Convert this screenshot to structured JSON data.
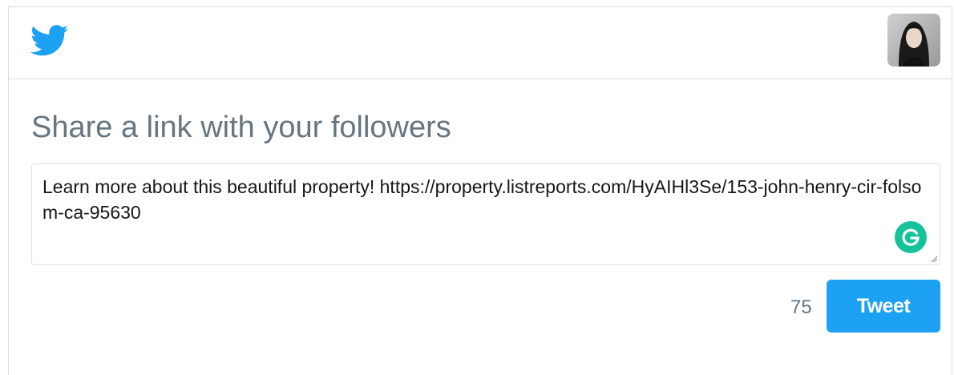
{
  "header": {
    "logo_icon": "twitter-bird-icon",
    "avatar_icon": "user-avatar"
  },
  "main": {
    "heading": "Share a link with your followers",
    "tweet_text": "Learn more about this beautiful property! https://property.listreports.com/HyAIHl3Se/153-john-henry-cir-folsom-ca-95630",
    "char_count": "75",
    "tweet_button_label": "Tweet",
    "grammarly_icon": "grammarly-icon"
  },
  "colors": {
    "brand_blue": "#1da1f2",
    "heading_gray": "#66757f",
    "grammarly_green": "#15c39a"
  }
}
